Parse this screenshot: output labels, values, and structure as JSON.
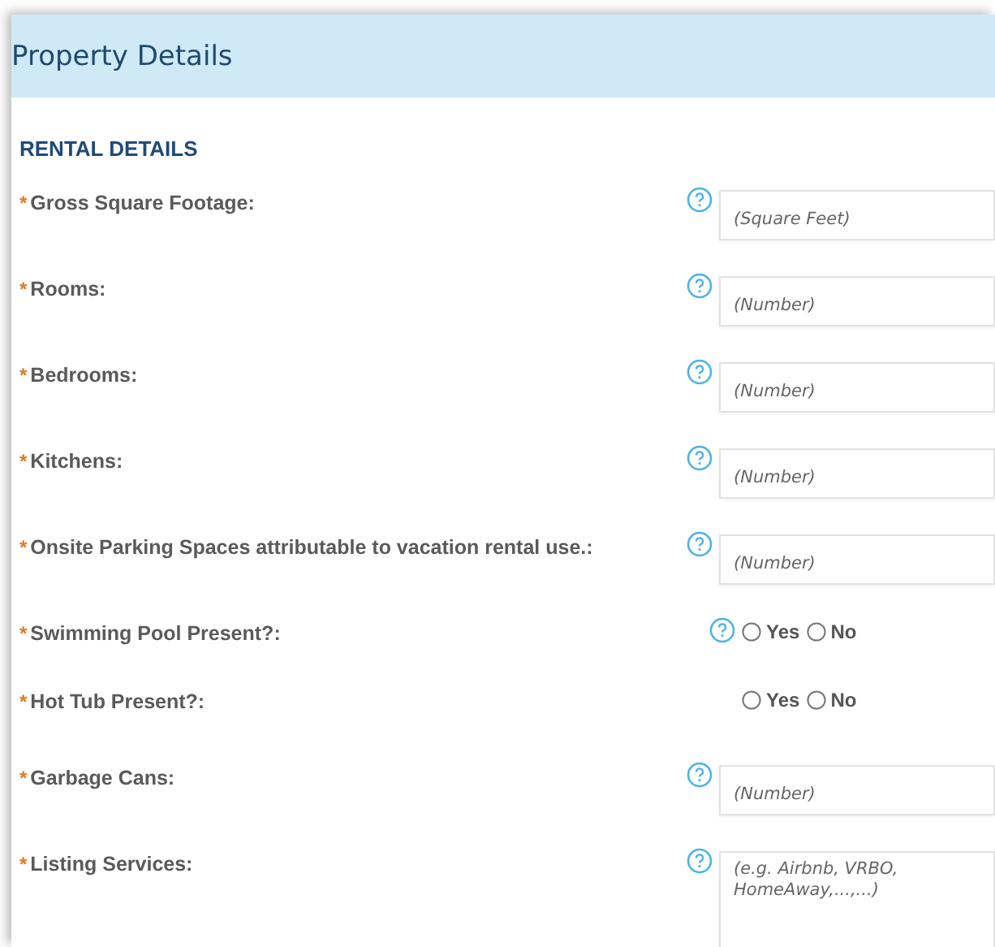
{
  "panel": {
    "title": "Property Details"
  },
  "section": {
    "title": "RENTAL DETAILS"
  },
  "fields": [
    {
      "kind": "text",
      "label": "Gross Square Footage:",
      "marker": "*",
      "help": true,
      "placeholder": "(Square Feet)"
    },
    {
      "kind": "text",
      "label": "Rooms:",
      "marker": "*",
      "help": true,
      "placeholder": "(Number)"
    },
    {
      "kind": "text",
      "label": "Bedrooms:",
      "marker": "*",
      "help": true,
      "placeholder": "(Number)"
    },
    {
      "kind": "text",
      "label": "Kitchens:",
      "marker": "*",
      "help": true,
      "placeholder": "(Number)"
    },
    {
      "kind": "text",
      "label": "Onsite Parking Spaces attributable to vacation rental use.:",
      "marker": "*",
      "help": true,
      "placeholder": "(Number)"
    },
    {
      "kind": "radio",
      "label": "Swimming Pool Present?:",
      "marker": "*",
      "help": true,
      "options": [
        {
          "label": "Yes",
          "selected": false
        },
        {
          "label": "No",
          "selected": false
        }
      ]
    },
    {
      "kind": "radio",
      "label": "Hot Tub Present?:",
      "marker": "*",
      "help": false,
      "options": [
        {
          "label": "Yes",
          "selected": false
        },
        {
          "label": "No",
          "selected": false
        }
      ]
    },
    {
      "kind": "text",
      "label": "Garbage Cans:",
      "marker": "*",
      "help": true,
      "placeholder": "(Number)"
    },
    {
      "kind": "textarea",
      "label": "Listing Services:",
      "marker": "*",
      "help": true,
      "placeholder": "(e.g. Airbnb, VRBO, HomeAway,...,...)"
    }
  ]
}
